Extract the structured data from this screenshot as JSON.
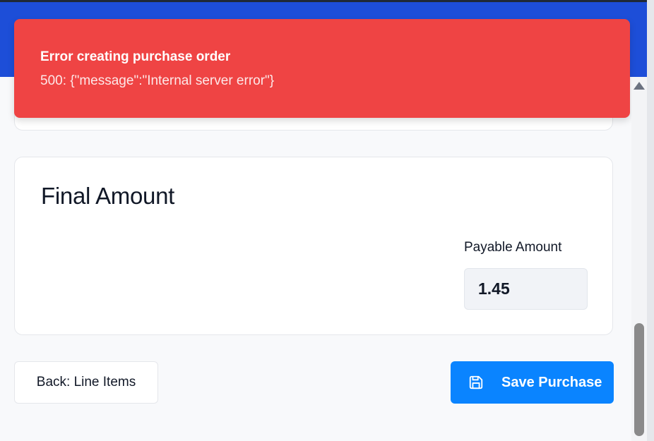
{
  "toast": {
    "title": "Error creating purchase order",
    "message": "500: {\"message\":\"Internal server error\"}",
    "color": "#ef4444"
  },
  "final_amount": {
    "title": "Final Amount",
    "payable_label": "Payable Amount",
    "payable_value": "1.45"
  },
  "actions": {
    "back_label": "Back: Line Items",
    "save_label": "Save Purchase",
    "save_icon": "save-icon",
    "save_color": "#0a84ff"
  },
  "header": {
    "color": "#1d4ed8"
  }
}
